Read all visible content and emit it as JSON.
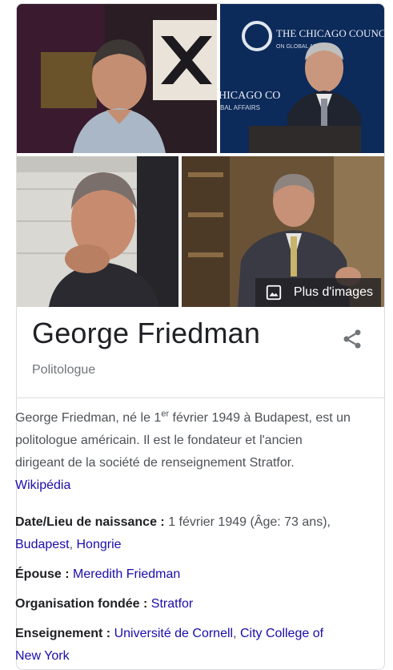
{
  "images": {
    "more_label": "Plus d'images"
  },
  "entity": {
    "name": "George Friedman",
    "subtitle": "Politologue"
  },
  "description": {
    "text_pre": "George Friedman, né le 1",
    "sup": "er",
    "text_post": " février 1949 à Budapest, est un politologue américain. Il est le fondateur et l'ancien dirigeant de la société de renseignement Stratfor. ",
    "source_link": "Wikipédia"
  },
  "facts": {
    "birth": {
      "label": "Date/Lieu de naissance : ",
      "value": "1 février 1949 (Âge: 73 ans), ",
      "link1": "Budapest",
      "sep": ", ",
      "link2": "Hongrie"
    },
    "spouse": {
      "label": "Épouse : ",
      "link": "Meredith Friedman"
    },
    "org": {
      "label": "Organisation fondée : ",
      "link": "Stratfor"
    },
    "education": {
      "label": "Enseignement : ",
      "link1": "Université de Cornell",
      "sep": ", ",
      "link2": "City College of New York"
    }
  },
  "overlay_texts": {
    "council_line1": "THE CHICAGO COUNC",
    "council_line2": "ON GLOBAL AFFAIRS",
    "council_line3": "HICAGO CO",
    "council_line4": "BAL AFFAIRS"
  },
  "colors": {
    "link": "#1a0dab",
    "text": "#202124",
    "muted": "#70757a",
    "border": "#dadce0"
  }
}
